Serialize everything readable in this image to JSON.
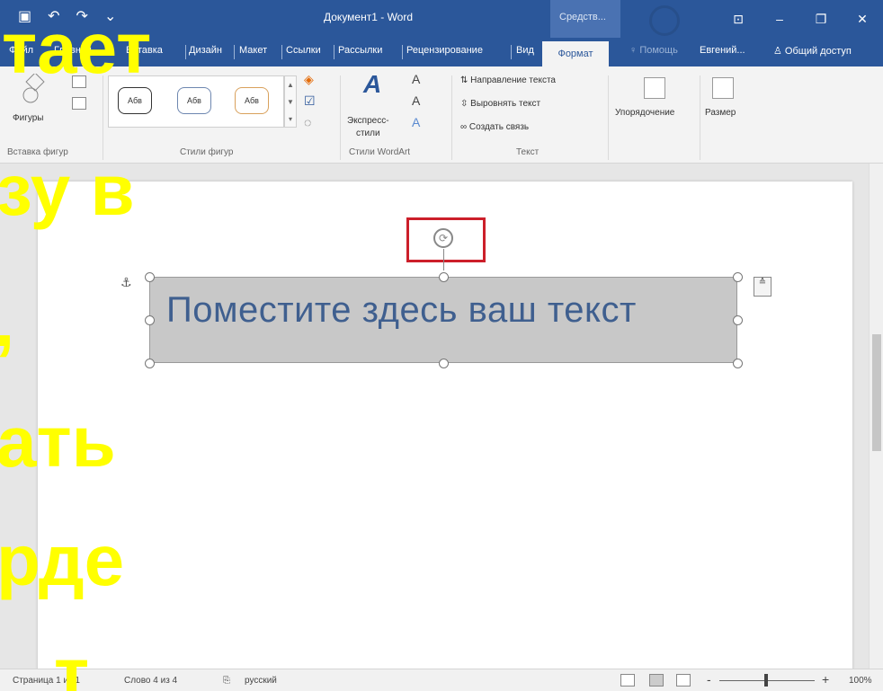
{
  "window": {
    "title": "Документ1 - Word",
    "context_tools": "Средств...",
    "win_buttons": [
      "⊡",
      "–",
      "❐",
      "✕"
    ]
  },
  "qat": {
    "icons": [
      "save-icon",
      "undo-icon",
      "redo-icon",
      "customize-icon"
    ]
  },
  "tabs": [
    {
      "label": "Файл"
    },
    {
      "label": "Главная"
    },
    {
      "label": "Вставка"
    },
    {
      "label": "Дизайн"
    },
    {
      "label": "Макет"
    },
    {
      "label": "Ссылки"
    },
    {
      "label": "Рассылки"
    },
    {
      "label": "Рецензирование"
    },
    {
      "label": "Вид"
    }
  ],
  "active_tab": "Формат",
  "help": "Помощь",
  "user": "Евгений...",
  "share": "Общий доступ",
  "ribbon": {
    "shapes": {
      "label": "Фигуры",
      "group": "Вставка фигур"
    },
    "shape_styles": {
      "chips": [
        "Абв",
        "Абв",
        "Абв"
      ],
      "group": "Стили фигур"
    },
    "wordart": {
      "label": "Экспресс-",
      "label2": "стили",
      "group": "Стили WordArt"
    },
    "text": {
      "items": [
        "Направление текста",
        "Выровнять текст",
        "Создать связь"
      ],
      "group": "Текст"
    },
    "arrange": "Упорядочение",
    "size": "Размер"
  },
  "document": {
    "textbox_text": "Поместите здесь ваш текст"
  },
  "status": {
    "page": "Страница 1 из 1",
    "words": "Слово 4 из 4",
    "lang": "русский",
    "zoom": "100%",
    "zoom_minus": "-",
    "zoom_plus": "+"
  },
  "overlay_lines": [
    "тает",
    "зу в",
    ",",
    "ать",
    "рде",
    "т"
  ],
  "colors": {
    "titlebar": "#2b579a",
    "overlay": "#ffff00",
    "highlight_box": "#cc1f2a"
  }
}
